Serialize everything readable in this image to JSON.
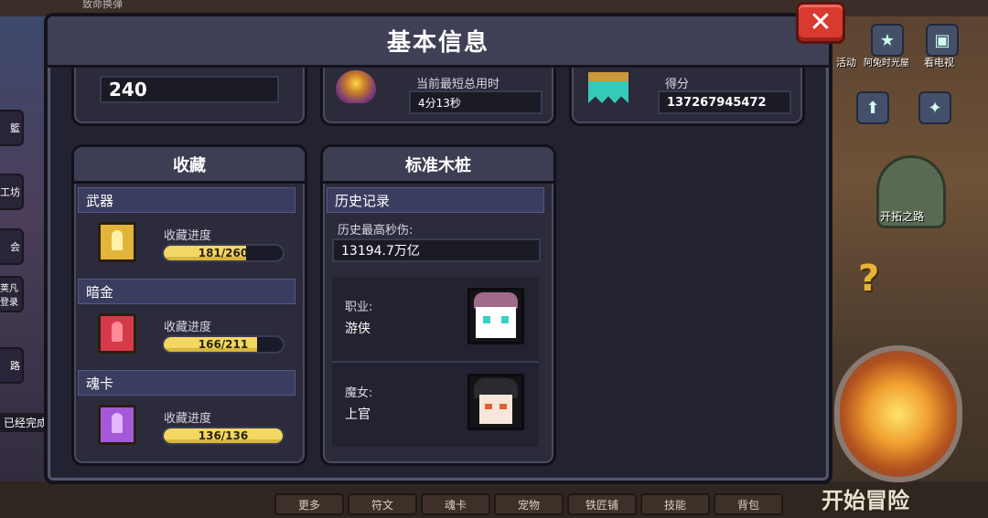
{
  "background": {
    "top_ghost_text": "致命换弹",
    "left_chips": [
      "籃",
      "工坊",
      "会",
      "荚凡 登录",
      "路"
    ],
    "done_text": "已经完成",
    "right_labels": [
      "活动",
      "阿兔时光屋",
      "看电视"
    ],
    "expand_label": "开拓之路",
    "qmark": "?",
    "start_label": "开始冒险",
    "bottom_tabs": [
      "更多",
      "符文",
      "魂卡",
      "宠物",
      "铁匠铺",
      "技能",
      "背包"
    ]
  },
  "panel": {
    "title": "基本信息",
    "close_symbol": "✕"
  },
  "top_row": {
    "left_value": "240",
    "middle_label": "当前最短总用时",
    "middle_value": "4分13秒",
    "right_label": "得分",
    "right_value": "137267945472"
  },
  "collection": {
    "title": "收藏",
    "rows": [
      {
        "name": "武器",
        "progress_label": "收藏进度",
        "current": 181,
        "total": 260,
        "text": "181/260",
        "book_color": "#e2b53a",
        "spine_color": "#fff2a8"
      },
      {
        "name": "暗金",
        "progress_label": "收藏进度",
        "current": 166,
        "total": 211,
        "text": "166/211",
        "book_color": "#d63a4a",
        "spine_color": "#ff8a98"
      },
      {
        "name": "魂卡",
        "progress_label": "收藏进度",
        "current": 136,
        "total": 136,
        "text": "136/136",
        "book_color": "#a45ad8",
        "spine_color": "#e2b8ff"
      }
    ]
  },
  "stump": {
    "title": "标准木桩",
    "history_header": "历史记录",
    "max_dps_label": "历史最高秒伤:",
    "max_dps_value": "13194.7万亿",
    "heroes": [
      {
        "role_label": "职业:",
        "name": "游侠",
        "hair": "#a06a8a",
        "face": "#ffffff",
        "eyes": "#3ad0c8"
      },
      {
        "role_label": "魔女:",
        "name": "上官",
        "hair": "#2a2a30",
        "face": "#f6e6dc",
        "eyes": "#e06030"
      }
    ]
  },
  "colors": {
    "panel_bg": "#2b2b3e",
    "header_bg": "#3f3f56",
    "progress_fill": "#f2d763",
    "close_red": "#d83a30"
  }
}
